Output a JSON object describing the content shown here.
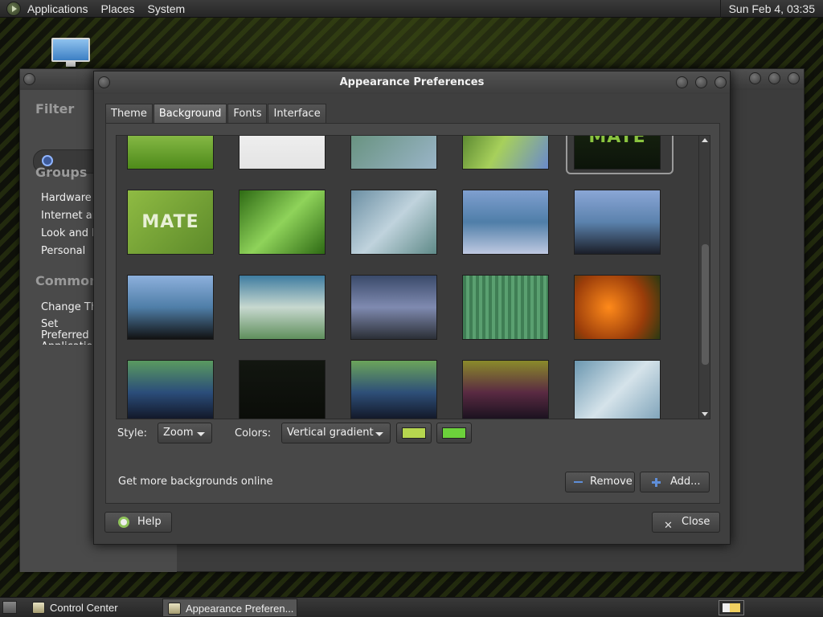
{
  "top_panel": {
    "menus": [
      "Applications",
      "Places",
      "System"
    ],
    "clock": "Sun Feb  4, 03:35"
  },
  "control_center": {
    "filter_label": "Filter",
    "groups_heading": "Groups",
    "groups": [
      "Hardware",
      "Internet and Network",
      "Look and Feel",
      "Personal"
    ],
    "common_heading": "Common",
    "common_tasks": [
      "Change Theme",
      "Set Preferred Applications"
    ]
  },
  "dialog": {
    "title": "Appearance Preferences",
    "tabs": [
      "Theme",
      "Background",
      "Fonts",
      "Interface"
    ],
    "active_tab": "Background",
    "thumbnails": [
      {
        "name": "grass",
        "bg": "linear-gradient(180deg,#b7e26a,#4e8a1a)"
      },
      {
        "name": "mate-light",
        "bg": "linear-gradient(180deg,#f7f7f7,#e4e4e4)"
      },
      {
        "name": "blue-green-waves",
        "bg": "linear-gradient(135deg,#5c8a6e,#9ab5c8)"
      },
      {
        "name": "green-leaf-flower",
        "bg": "linear-gradient(120deg,#3f6e22,#a7d05b,#6a8acb)"
      },
      {
        "name": "mate-dark",
        "bg": "linear-gradient(180deg,#1c2a12,#0c140a)",
        "label": "MATE",
        "label_color": "#8ac43f",
        "selected": true
      },
      {
        "name": "mate-green",
        "bg": "linear-gradient(135deg,#8fbb43,#5d8a2a)",
        "label": "MATE",
        "label_color": "#e8f0d6"
      },
      {
        "name": "water-leaf",
        "bg": "linear-gradient(135deg,#2e6a14,#8fd35a,#2e6a14)"
      },
      {
        "name": "soft-blue-waves",
        "bg": "linear-gradient(135deg,#6b8fa3,#c0d3dd,#5f8a88)"
      },
      {
        "name": "blue-abstract-1",
        "bg": "linear-gradient(180deg,#7f9fcf,#4f7ea8,#bfc9e1)"
      },
      {
        "name": "blue-abstract-2",
        "bg": "linear-gradient(180deg,#8aa6d6,#5b82ad,#1b1e28)"
      },
      {
        "name": "blue-abstract-3",
        "bg": "linear-gradient(180deg,#8db0dc,#4f7ea8,#111)"
      },
      {
        "name": "green-blue-wave",
        "bg": "linear-gradient(180deg,#3e7ca0,#c7d8cf,#5f8f5c)"
      },
      {
        "name": "storm-road",
        "bg": "linear-gradient(180deg,#3a4a6a,#7f8ab0,#2b2f36)"
      },
      {
        "name": "green-curtain",
        "bg": "repeating-linear-gradient(90deg,#3f7e54 0 4px,#5aa070 4px 8px)"
      },
      {
        "name": "orange-flowers",
        "bg": "radial-gradient(circle at 40% 50%,#ff8a1a,#9b3d0a 60%,#2a3a12)"
      },
      {
        "name": "aurora-1",
        "bg": "linear-gradient(180deg,#5a9a5f,#2b4d7a,#0d0d18)"
      },
      {
        "name": "dark-plain",
        "bg": "linear-gradient(180deg,#121610,#0a0c08)"
      },
      {
        "name": "aurora-2",
        "bg": "linear-gradient(180deg,#6ba45a,#2e4f78,#0d0d18)"
      },
      {
        "name": "aurora-3",
        "bg": "linear-gradient(180deg,#8a8a2a,#5a2a42,#0d0d18)"
      },
      {
        "name": "light-blue-waves",
        "bg": "linear-gradient(135deg,#6b97b0,#d5e3ea,#7aa0b7)"
      }
    ],
    "style_label": "Style:",
    "style_value": "Zoom",
    "colors_label": "Colors:",
    "colors_value": "Vertical gradient",
    "color1": "#b6d64f",
    "color2": "#6cd13b",
    "more_link": "Get more backgrounds online",
    "remove_label": "Remove",
    "add_label": "Add...",
    "help_label": "Help",
    "close_label": "Close"
  },
  "bottom_panel": {
    "tasks": [
      "Control Center",
      "Appearance Preferen..."
    ]
  }
}
